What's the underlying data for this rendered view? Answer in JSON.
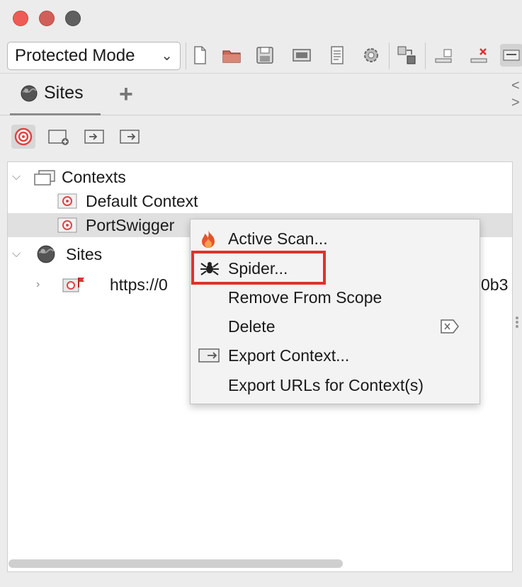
{
  "window": {
    "buttons": [
      "close",
      "minimize",
      "maximize"
    ]
  },
  "toolbar": {
    "mode_value": "Protected Mode",
    "icons": [
      "new-session-icon",
      "open-session-icon",
      "save-session-icon",
      "snapshot-icon",
      "session-properties-icon",
      "options-gear-icon",
      "layout-icon",
      "show-tabs-icon",
      "hide-tabs-icon",
      "expand-icon"
    ]
  },
  "tabs": {
    "sites_label": "Sites",
    "add_label": "+",
    "scroll_left": "<",
    "scroll_right": ">"
  },
  "subtoolbar": {
    "icons": [
      "scope-target-icon",
      "new-context-icon",
      "import-context-icon",
      "export-context-icon"
    ]
  },
  "tree": {
    "contexts_label": "Contexts",
    "default_context_label": "Default Context",
    "portswigger_label": "PortSwigger",
    "sites_label": "Sites",
    "site_url_start": "https://0",
    "site_url_end": "0b3"
  },
  "context_menu": {
    "items": [
      {
        "label": "Active Scan...",
        "icon": "flame-icon"
      },
      {
        "label": "Spider...",
        "icon": "spider-icon"
      },
      {
        "label": "Remove From Scope",
        "icon": ""
      },
      {
        "label": "Delete",
        "icon": "",
        "right_icon": "delete-key-icon"
      },
      {
        "label": "Export Context...",
        "icon": "export-icon"
      },
      {
        "label": "Export URLs for Context(s)",
        "icon": ""
      }
    ],
    "highlighted_item": "Spider...",
    "highlight_color": "#e0322b"
  }
}
